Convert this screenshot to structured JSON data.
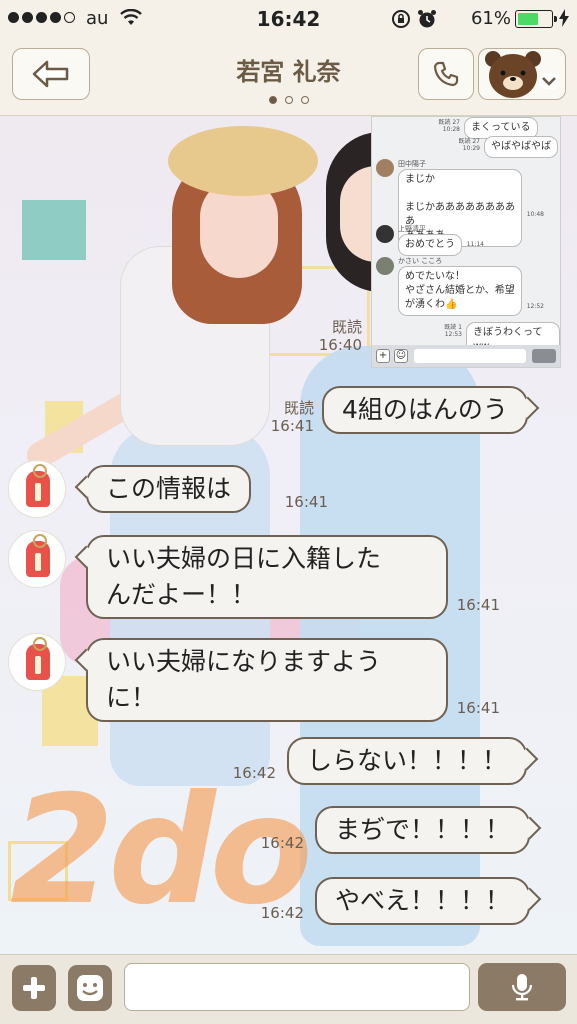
{
  "status_bar": {
    "carrier": "au",
    "time": "16:42",
    "battery": "61%",
    "battery_level": 0.61
  },
  "header": {
    "title": "若宮 礼奈",
    "page_count": 3,
    "active_page": 1
  },
  "embedded_screenshot": {
    "messages": [
      {
        "side": "right",
        "read": "既読 27",
        "time": "10:28",
        "text": "まくっている"
      },
      {
        "side": "right",
        "read": "既読 27",
        "time": "10:29",
        "text": "やばやばやば"
      },
      {
        "side": "left",
        "sender": "田中陽子",
        "time": "10:48",
        "lines": [
          "まじか",
          "",
          "まじかあああああああああ",
          "ああああ"
        ]
      },
      {
        "side": "left",
        "sender": "上野清平",
        "time": "11:14",
        "text": "おめでとう"
      },
      {
        "side": "left",
        "sender": "かさい こころ",
        "time": "12:52",
        "lines": [
          "めでたいな！",
          "やざさん結婚とか、希望",
          "が湧くわ👍"
        ]
      },
      {
        "side": "right",
        "read": "既読 1",
        "time": "12:53",
        "text": "きぼうわくってww"
      }
    ]
  },
  "messages": [
    {
      "id": "m1",
      "side": "right",
      "read": "既読",
      "time": "16:40",
      "text": ""
    },
    {
      "id": "m2",
      "side": "right",
      "read": "既読",
      "time": "16:41",
      "text": "4組のはんのう"
    },
    {
      "id": "m3",
      "side": "left",
      "time": "16:41",
      "text": "この情報は"
    },
    {
      "id": "m4",
      "side": "left",
      "time": "16:41",
      "lines": [
        "いい夫婦の日に入籍した",
        "んだよー！！"
      ]
    },
    {
      "id": "m5",
      "side": "left",
      "time": "16:41",
      "lines": [
        "いい夫婦になりますよう",
        "に！"
      ]
    },
    {
      "id": "m6",
      "side": "right",
      "time": "16:42",
      "text": "しらない！！！！"
    },
    {
      "id": "m7",
      "side": "right",
      "time": "16:42",
      "text": "まぢで！！！！"
    },
    {
      "id": "m8",
      "side": "right",
      "time": "16:42",
      "text": "やべえ！！！！"
    }
  ],
  "background_text": "2do",
  "input": {
    "placeholder": ""
  },
  "colors": {
    "accent_brown": "#8a7a66",
    "bubble_border": "#6f6253",
    "battery_green": "#4cd964"
  },
  "icons": [
    "back-arrow-icon",
    "phone-icon",
    "bear-avatar-icon",
    "chevron-down-icon",
    "plus-icon",
    "sticker-face-icon",
    "microphone-icon",
    "wifi-icon",
    "rotation-lock-icon",
    "alarm-icon",
    "battery-icon",
    "charging-icon"
  ]
}
